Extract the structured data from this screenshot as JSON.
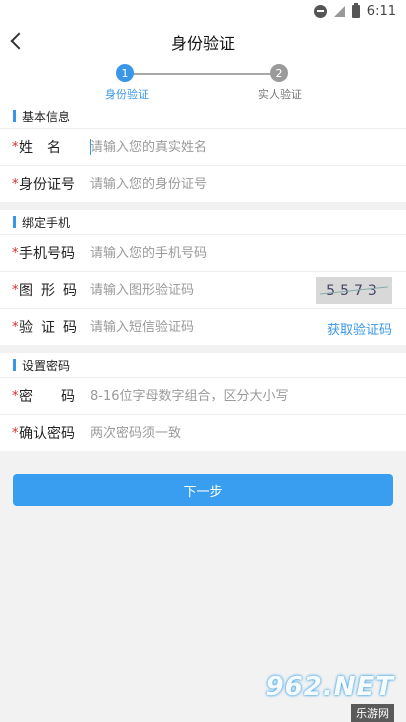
{
  "statusbar": {
    "time": "6:11"
  },
  "titlebar": {
    "title": "身份验证"
  },
  "steps": [
    {
      "number": "1",
      "label": "身份验证",
      "active": true
    },
    {
      "number": "2",
      "label": "实人验证",
      "active": false
    }
  ],
  "sections": {
    "basic": {
      "header": "基本信息",
      "name": {
        "star": "*",
        "label": "姓　名",
        "placeholder": "请输入您的真实姓名"
      },
      "idcard": {
        "star": "*",
        "label": "身份证号",
        "placeholder": "请输入您的身份证号"
      }
    },
    "phone": {
      "header": "绑定手机",
      "mobile": {
        "star": "*",
        "label": "手机号码",
        "placeholder": "请输入您的手机号码"
      },
      "captcha": {
        "star": "*",
        "label": "图形码",
        "placeholder": "请输入图形验证码",
        "image_text": "5573"
      },
      "sms": {
        "star": "*",
        "label": "验证码",
        "placeholder": "请输入短信验证码",
        "get_code": "获取验证码"
      }
    },
    "password": {
      "header": "设置密码",
      "pwd": {
        "star": "*",
        "label": "密码",
        "placeholder": "8-16位字母数字组合，区分大小写"
      },
      "confirm": {
        "star": "*",
        "label": "确认密码",
        "placeholder": "两次密码须一致"
      }
    }
  },
  "next_button": "下一步",
  "watermark": {
    "main": "962.NET",
    "sub": "乐游网"
  },
  "colors": {
    "accent": "#3a97e8",
    "required": "#d92b2b",
    "background": "#f2f2f2"
  }
}
